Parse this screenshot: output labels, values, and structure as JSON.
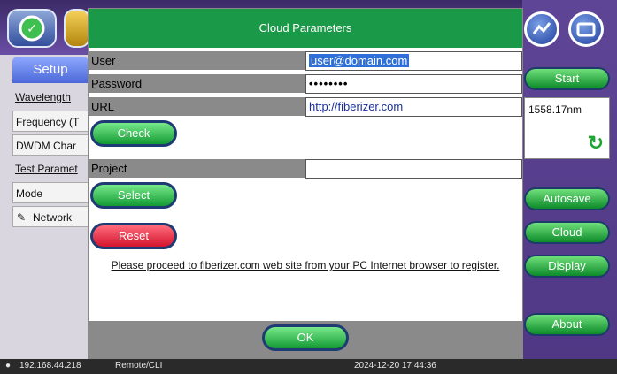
{
  "dialog": {
    "title": "Cloud Parameters",
    "fields": [
      {
        "label": "User",
        "value": "user@domain.com"
      },
      {
        "label": "Password",
        "value": "••••••••"
      },
      {
        "label": "URL",
        "value": "http://fiberizer.com"
      },
      {
        "label": "Project",
        "value": ""
      }
    ],
    "check_label": "Check",
    "select_label": "Select",
    "reset_label": "Reset",
    "note": "Please proceed to fiberizer.com web site from your PC Internet browser to register.",
    "ok_label": "OK"
  },
  "left_panel": {
    "tab_label": "Setup",
    "rows": [
      {
        "label": "Wavelength",
        "kind": "header"
      },
      {
        "label": "Frequency (T",
        "kind": "box"
      },
      {
        "label": "DWDM Char",
        "kind": "box"
      },
      {
        "label": "Test Paramet",
        "kind": "header"
      },
      {
        "label": "Mode",
        "kind": "box"
      },
      {
        "label": "Network",
        "kind": "box"
      }
    ]
  },
  "right_panel": {
    "start_label": "Start",
    "wavelength_value": "1558.17nm",
    "autosave_label": "Autosave",
    "cloud_label": "Cloud",
    "display_label": "Display",
    "about_label": "About"
  },
  "status_bar": {
    "ip": "192.168.44.218",
    "remote": "Remote/CLI",
    "datetime": "2024-12-20 17:44:36"
  },
  "colors": {
    "title_bar": "#1a9a49",
    "accent_green": "#139a34",
    "reset_red": "#d3152f",
    "frame_purple": "#5a3f8c"
  }
}
